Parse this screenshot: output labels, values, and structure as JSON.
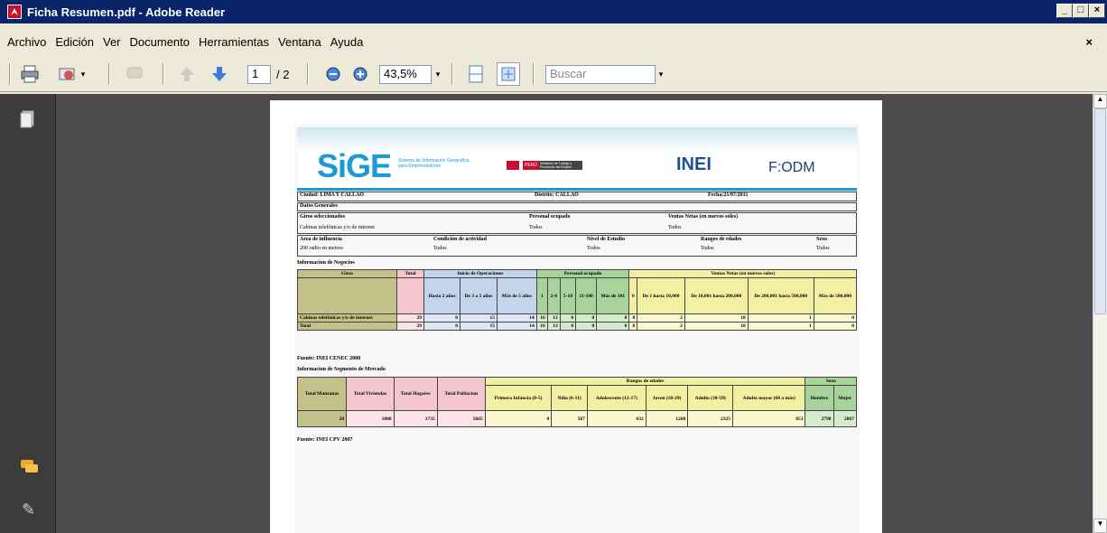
{
  "window": {
    "title": "Ficha Resumen.pdf - Adobe Reader"
  },
  "menu": [
    "Archivo",
    "Edición",
    "Ver",
    "Documento",
    "Herramientas",
    "Ventana",
    "Ayuda"
  ],
  "toolbar": {
    "page_current": "1",
    "page_total": "/ 2",
    "zoom": "43,5%",
    "search_placeholder": "Buscar"
  },
  "doc": {
    "logos": {
      "sige": "SiGE",
      "sige_sub": "Sistema de Información Geográfica para Emprendedores",
      "peru": "PERÚ",
      "peru_sub": "Ministerio de Trabajo y Promoción del Empleo",
      "inei": "INEI",
      "fodm": "F:ODM"
    },
    "ciudad": "Ciudad: LIMA Y CALLAO",
    "distrito": "Distrito: CALLAO",
    "fecha": "Fecha:21/07/2011",
    "datos_generales": "Datos Generales",
    "giros_label": "Giros seleccionados",
    "giros_value": "Cabinas telefónicas y/o de internet",
    "personal_label": "Personal ocupado",
    "personal_value": "Todos",
    "ventas_label": "Ventas Netas (en nuevos soles)",
    "ventas_value": "Todos",
    "area_label": "Area de influencia",
    "area_value": "200 radio en metros",
    "condicion_label": "Condición de actividad",
    "condicion_value": "Todos",
    "nivel_label": "Nivel de Estudio",
    "nivel_value": "Todos",
    "rangos_label": "Rangos de edades",
    "rangos_value": "Todos",
    "sexo_label": "Sexo",
    "sexo_value": "Todos",
    "info_negocios": "Informacion de Negocios",
    "fuente1": "Fuente: INEI CENEC 2008",
    "info_segmento": "Informacion de Segmento de Mercado",
    "fuente2": "Fuente: INEI CPV 2007",
    "t1": {
      "h": {
        "giros": "Giros",
        "total": "Total",
        "inicio": "Inicio de Operaciones",
        "personal": "Personal ocupado",
        "ventas": "Ventas Netas (en nuevos soles)"
      },
      "sub": [
        "Hasta 2 años",
        "De 3 a 5 años",
        "Más de 5 años",
        "1",
        "2-4",
        "5-10",
        "11-100",
        "Más de 101",
        "0",
        "De 1 hasta 10,000",
        "De 10,001 hasta 200,000",
        "De 200,001 hasta 500,000",
        "Más de 500,000"
      ],
      "rows": [
        {
          "name": "Cabinas telefónicas y/o de internet",
          "vals": [
            "29",
            "0",
            "15",
            "14",
            "16",
            "13",
            "0",
            "0",
            "0",
            "8",
            "2",
            "18",
            "1",
            "0"
          ]
        },
        {
          "name": "Total",
          "vals": [
            "29",
            "0",
            "15",
            "14",
            "16",
            "13",
            "0",
            "0",
            "0",
            "8",
            "2",
            "18",
            "1",
            "0"
          ]
        }
      ]
    },
    "t2": {
      "h": [
        "Total Manzanas",
        "Total Viviendas",
        "Total Hogares",
        "Total Poblacion"
      ],
      "rangos": "Rangos de edades",
      "sexo": "Sexo",
      "sub": [
        "Primera Infancia (0-5)",
        "Niño (6-11)",
        "Adolescente (12-17)",
        "Joven (18-29)",
        "Adulto (30-59)",
        "Adulto mayor (60 a más)",
        "Hombre",
        "Mujer"
      ],
      "vals": [
        "20",
        "1800",
        "1735",
        "5665",
        "0",
        "587",
        "632",
        "1268",
        "2325",
        "853",
        "2798",
        "2867"
      ]
    }
  }
}
